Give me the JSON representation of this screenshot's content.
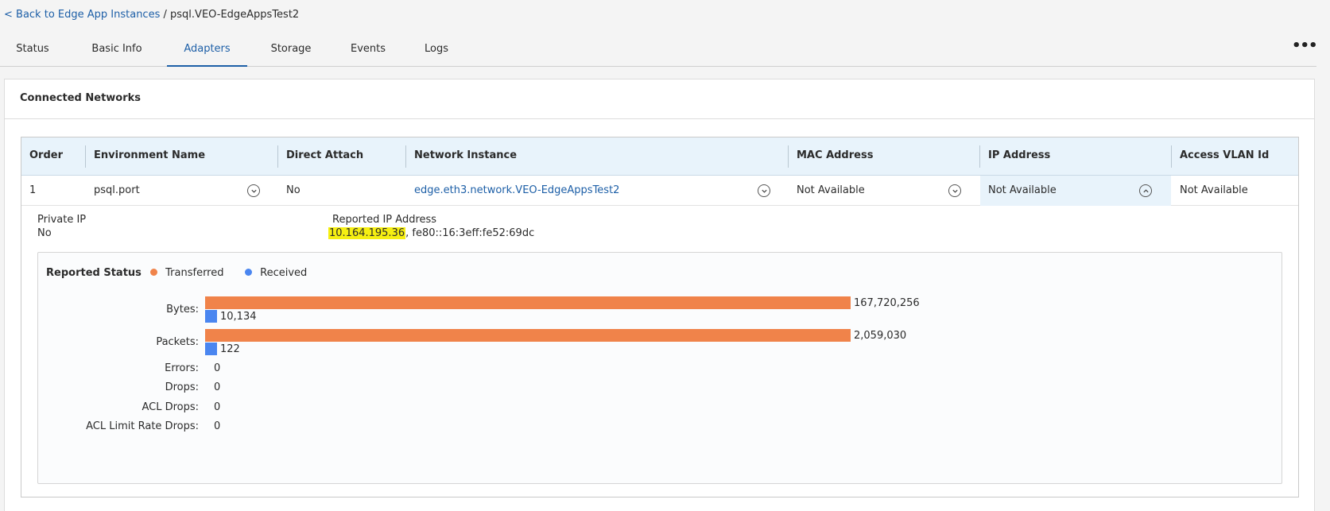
{
  "breadcrumb": {
    "back_link": "< Back to Edge App Instances",
    "separator": "/",
    "current": "psql.VEO-EdgeAppsTest2"
  },
  "tabs": [
    "Status",
    "Basic Info",
    "Adapters",
    "Storage",
    "Events",
    "Logs"
  ],
  "active_tab": "Adapters",
  "more_icon": "more-horizontal-icon",
  "section": {
    "title": "Connected Networks"
  },
  "table": {
    "headers": [
      "Order",
      "Environment Name",
      "Direct Attach",
      "Network Instance",
      "MAC Address",
      "IP Address",
      "Access VLAN Id"
    ],
    "row": {
      "order": "1",
      "environment_name": "psql.port",
      "direct_attach": "No",
      "network_instance": "edge.eth3.network.VEO-EdgeAppsTest2",
      "mac_address": "Not Available",
      "ip_address": "Not Available",
      "access_vlan_id": "Not Available"
    }
  },
  "details": {
    "private_ip_label": "Private IP",
    "private_ip_value": "No",
    "reported_ip_label": "Reported IP Address",
    "reported_ip_highlighted": "10.164.195.36",
    "reported_ip_rest": ", fe80::16:3eff:fe52:69dc"
  },
  "reported_status": {
    "title": "Reported Status",
    "legend": [
      {
        "name": "Transferred",
        "color": "#f0834a"
      },
      {
        "name": "Received",
        "color": "#4a86f0"
      }
    ],
    "metrics": {
      "bytes": {
        "label": "Bytes:",
        "transferred": 167720256,
        "transferred_text": "167,720,256",
        "received": 10134,
        "received_text": "10,134"
      },
      "packets": {
        "label": "Packets:",
        "transferred": 2059030,
        "transferred_text": "2,059,030",
        "received": 122,
        "received_text": "122"
      },
      "errors": {
        "label": "Errors:",
        "value": "0"
      },
      "drops": {
        "label": "Drops:",
        "value": "0"
      },
      "acl_drops": {
        "label": "ACL Drops:",
        "value": "0"
      },
      "acl_limit_rate_drops": {
        "label": "ACL Limit Rate Drops:",
        "value": "0"
      }
    }
  },
  "colors": {
    "link": "#1d5fa7",
    "header_bg": "#e8f3fb",
    "highlight": "#f6ef12"
  }
}
